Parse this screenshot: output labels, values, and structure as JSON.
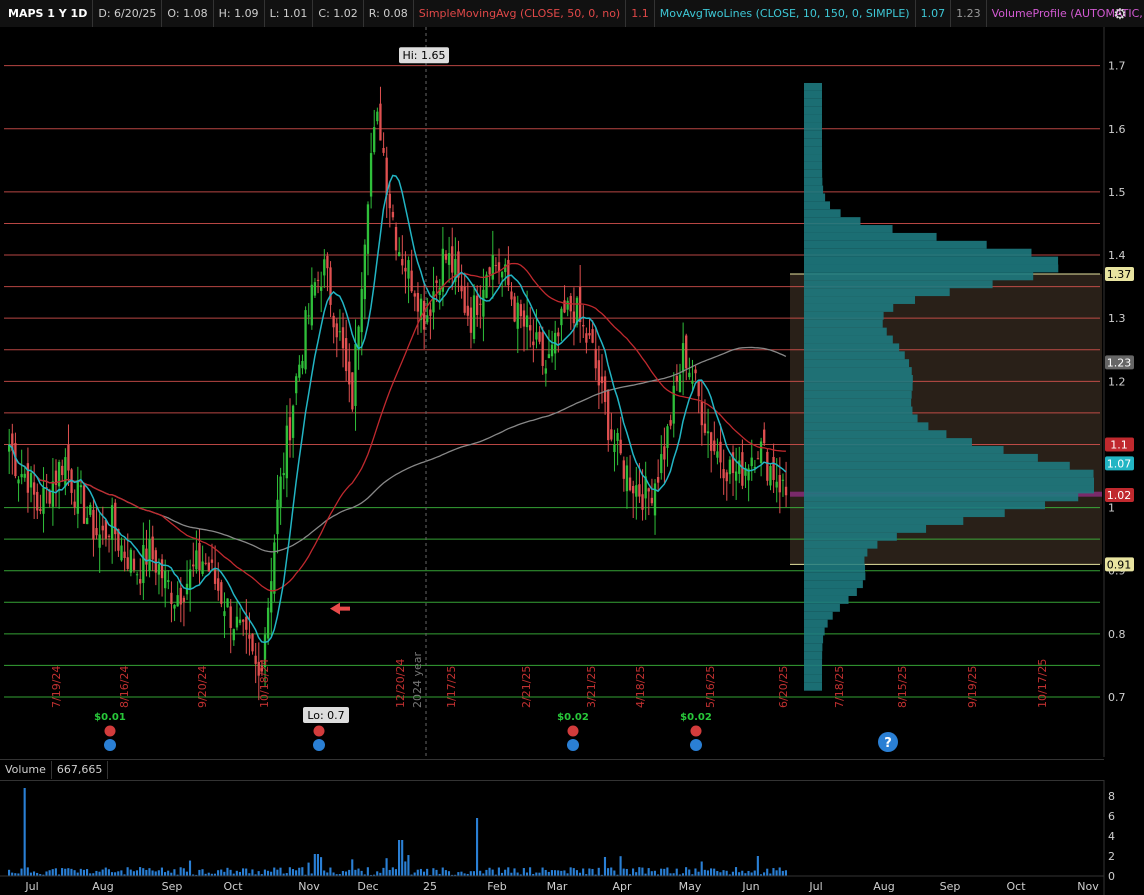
{
  "header": {
    "symbol": "MAPS 1 Y 1D",
    "date": "D: 6/20/25",
    "open": "O: 1.08",
    "high": "H: 1.09",
    "low": "L: 1.01",
    "close": "C: 1.02",
    "range": "R: 0.08",
    "sma_label": "SimpleMovingAvg (CLOSE, 50, 0, no)",
    "sma_value": "1.1",
    "mavg_label": "MovAvgTwoLines (CLOSE, 10, 150, 0, SIMPLE)",
    "mavg_value1": "1.07",
    "mavg_value2": "1.23",
    "vp_label": "VolumeProfile (AUTOMATIC, 2.0,..."
  },
  "volume_header": {
    "label": "Volume",
    "value": "667,665"
  },
  "colors": {
    "up": "#2fbf3a",
    "down": "#e05050",
    "sma": "#c0292e",
    "ma_fast": "#22b5c4",
    "ma_slow": "#888888",
    "resistance": "#d9534f",
    "support": "#3fbf3f",
    "profile": "#1e7a80",
    "value_area": "#4a3a2c",
    "volume": "#2a7fd4",
    "dividend": "#28c83a"
  },
  "chart_data": {
    "type": "candlestick",
    "ylim": [
      0.7,
      1.72
    ],
    "y_ticks": [
      "1.7",
      "1.6",
      "1.5",
      "1.4",
      "1.3",
      "1.2",
      "1.1",
      "1",
      "0.9",
      "0.8",
      "0.7"
    ],
    "x_months": [
      "Jul",
      "Aug",
      "Sep",
      "Oct",
      "Nov",
      "Dec",
      "25",
      "Feb",
      "Mar",
      "Apr",
      "May",
      "Jun",
      "Jul",
      "Aug",
      "Sep",
      "Oct",
      "Nov"
    ],
    "rotated_dates": [
      "7/19/24",
      "8/16/24",
      "9/20/24",
      "10/18/24",
      "12/20/24",
      "1/17/25",
      "2/21/25",
      "3/21/25",
      "4/18/25",
      "5/16/25",
      "6/20/25",
      "7/18/25",
      "8/15/25",
      "9/19/25",
      "10/17/25"
    ],
    "year_marker": "2024 year",
    "resistance_lines": [
      1.7,
      1.6,
      1.5,
      1.45,
      1.4,
      1.35,
      1.3,
      1.25,
      1.2,
      1.15,
      1.1
    ],
    "support_lines": [
      1.0,
      0.95,
      0.9,
      0.85,
      0.8,
      0.75,
      0.7
    ],
    "hi_label": "Hi: 1.65",
    "lo_label": "Lo: 0.7",
    "price_labels": [
      {
        "text": "1.37",
        "value": 1.37,
        "bg": "#e8e4a0"
      },
      {
        "text": "1.23",
        "value": 1.23,
        "bg": "#666666"
      },
      {
        "text": "1.1",
        "value": 1.1,
        "bg": "#c0292e"
      },
      {
        "text": "1.07",
        "value": 1.07,
        "bg": "#22b5c4"
      },
      {
        "text": "1.02",
        "value": 1.02,
        "bg": "#c0292e"
      },
      {
        "text": "0.91",
        "value": 0.91,
        "bg": "#e8e4a0"
      }
    ],
    "value_area": [
      0.91,
      1.37
    ],
    "dividends": [
      {
        "label": "$0.01",
        "date": "8/16/24"
      },
      {
        "label": "$0.02",
        "date": "3/21/25"
      },
      {
        "label": "$0.02",
        "date": "5/16/25"
      }
    ],
    "events_extra": [
      "11/8/24"
    ],
    "question_mark": "?",
    "volume_ticks": [
      "8",
      "6",
      "4",
      "2",
      "0"
    ],
    "closes_sample": [
      1.1,
      1.06,
      1.05,
      1.0,
      1.02,
      1.05,
      1.08,
      1.03,
      1.0,
      0.97,
      0.95,
      0.98,
      0.94,
      0.92,
      0.9,
      0.93,
      0.91,
      0.88,
      0.86,
      0.88,
      0.9,
      0.92,
      0.89,
      0.86,
      0.83,
      0.8,
      0.77,
      0.73,
      0.85,
      1.0,
      1.1,
      1.2,
      1.28,
      1.35,
      1.38,
      1.32,
      1.25,
      1.15,
      1.35,
      1.55,
      1.62,
      1.5,
      1.42,
      1.38,
      1.35,
      1.3,
      1.35,
      1.4,
      1.38,
      1.33,
      1.3,
      1.35,
      1.4,
      1.38,
      1.35,
      1.3,
      1.28,
      1.25,
      1.22,
      1.25,
      1.3,
      1.32,
      1.28,
      1.25,
      1.18,
      1.12,
      1.08,
      1.05,
      1.03,
      1.02,
      1.05,
      1.1,
      1.18,
      1.25,
      1.2,
      1.15,
      1.1,
      1.08,
      1.06,
      1.05,
      1.08,
      1.1,
      1.07,
      1.05,
      1.02
    ]
  }
}
